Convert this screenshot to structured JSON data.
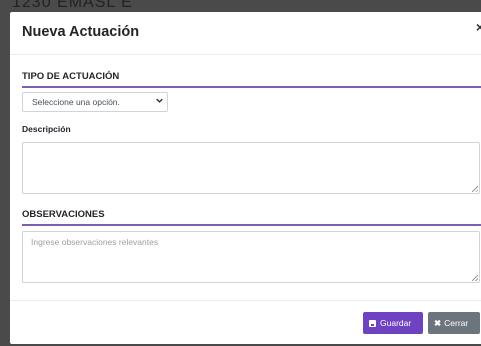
{
  "backdrop": {
    "text": "1230 EMASL E"
  },
  "modal": {
    "title": "Nueva Actuación",
    "close_glyph": "×"
  },
  "tipo_actuacion": {
    "section_title": "TIPO DE ACTUACIÓN",
    "select_value": "Seleccione una opción.",
    "select_icon": "chevron-down-icon"
  },
  "descripcion": {
    "label": "Descripción",
    "value": ""
  },
  "observaciones": {
    "section_title": "OBSERVACIONES",
    "placeholder": "Ingrese observaciones relevantes"
  },
  "footer": {
    "save_label": "Guardar",
    "save_icon": "save-icon",
    "close_label": "Cerrar",
    "close_icon": "close-icon"
  },
  "colors": {
    "accent": "#6f42c1",
    "section_line": "#7c5fae",
    "secondary_button": "#6c757d"
  }
}
